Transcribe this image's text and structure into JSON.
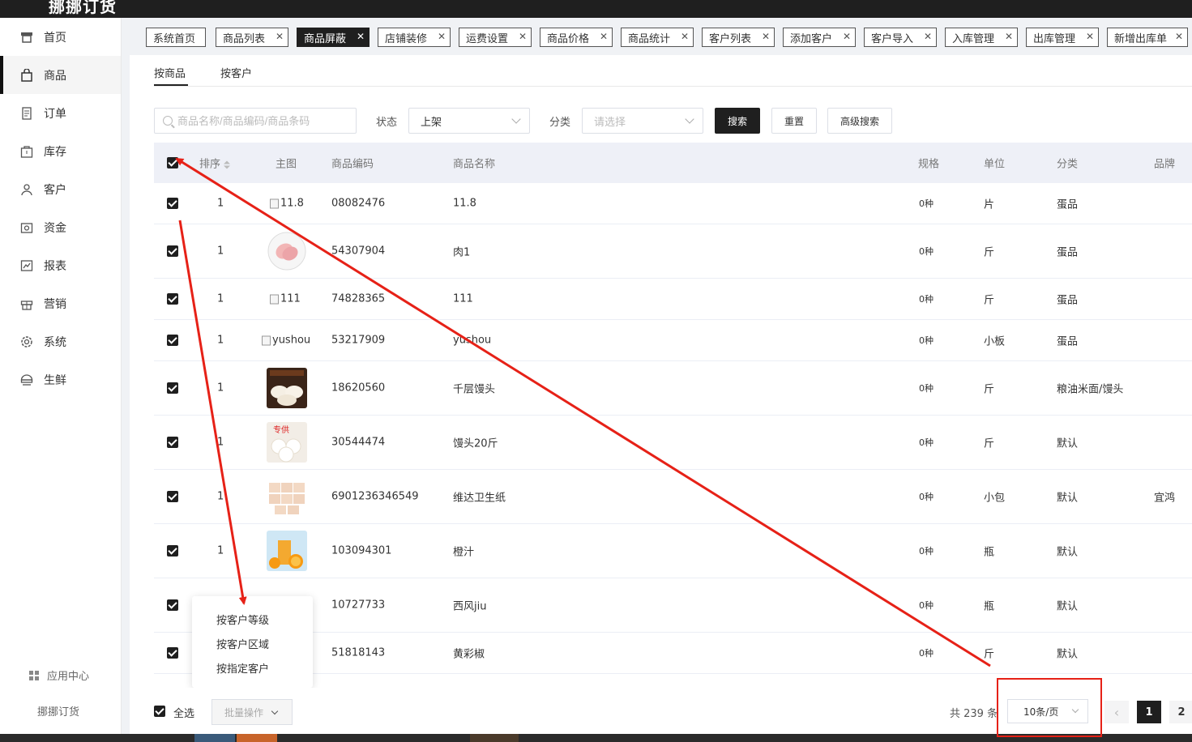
{
  "app": {
    "brand": "挪挪订货"
  },
  "sidebar": {
    "items": [
      {
        "label": "首页",
        "icon": "storefront-icon"
      },
      {
        "label": "商品",
        "icon": "shopping-bag-icon",
        "active": true
      },
      {
        "label": "订单",
        "icon": "document-icon"
      },
      {
        "label": "库存",
        "icon": "box-icon"
      },
      {
        "label": "客户",
        "icon": "user-icon"
      },
      {
        "label": "资金",
        "icon": "wallet-icon"
      },
      {
        "label": "报表",
        "icon": "chart-icon"
      },
      {
        "label": "营销",
        "icon": "gift-icon"
      },
      {
        "label": "系统",
        "icon": "gear-icon"
      },
      {
        "label": "生鲜",
        "icon": "food-icon"
      }
    ],
    "app_center": "应用中心",
    "footer_brand": "挪挪订货"
  },
  "tabs": [
    {
      "label": "系统首页",
      "closable": false
    },
    {
      "label": "商品列表",
      "closable": true
    },
    {
      "label": "商品屏蔽",
      "closable": true,
      "active": true
    },
    {
      "label": "店铺装修",
      "closable": true
    },
    {
      "label": "运费设置",
      "closable": true
    },
    {
      "label": "商品价格",
      "closable": true
    },
    {
      "label": "商品统计",
      "closable": true
    },
    {
      "label": "客户列表",
      "closable": true
    },
    {
      "label": "添加客户",
      "closable": true
    },
    {
      "label": "客户导入",
      "closable": true
    },
    {
      "label": "入库管理",
      "closable": true
    },
    {
      "label": "出库管理",
      "closable": true
    },
    {
      "label": "新增出库单",
      "closable": true
    }
  ],
  "subtabs": [
    {
      "label": "按商品",
      "active": true
    },
    {
      "label": "按客户"
    }
  ],
  "filters": {
    "search_placeholder": "商品名称/商品编码/商品条码",
    "status_label": "状态",
    "status_value": "上架",
    "category_label": "分类",
    "category_placeholder": "请选择",
    "search_btn": "搜索",
    "reset_btn": "重置",
    "advanced_btn": "高级搜索"
  },
  "table": {
    "headers": {
      "sort": "排序",
      "image": "主图",
      "code": "商品编码",
      "name": "商品名称",
      "spec": "规格",
      "unit": "单位",
      "category": "分类",
      "brand": "品牌"
    },
    "rows": [
      {
        "sort": "1",
        "image_alt": "11.8",
        "image": "broken",
        "code": "08082476",
        "name": "11.8",
        "spec": "0种",
        "unit": "片",
        "category": "蛋品",
        "brand": ""
      },
      {
        "sort": "1",
        "image": "meat",
        "code": "54307904",
        "name": "肉1",
        "spec": "0种",
        "unit": "斤",
        "category": "蛋品",
        "brand": ""
      },
      {
        "sort": "1",
        "image_alt": "111",
        "image": "broken",
        "code": "74828365",
        "name": "111",
        "spec": "0种",
        "unit": "斤",
        "category": "蛋品",
        "brand": ""
      },
      {
        "sort": "1",
        "image_alt": "yushou",
        "image": "broken",
        "code": "53217909",
        "name": "yushou",
        "spec": "0种",
        "unit": "小板",
        "category": "蛋品",
        "brand": ""
      },
      {
        "sort": "1",
        "image": "buns-dark",
        "code": "18620560",
        "name": "千层馒头",
        "spec": "0种",
        "unit": "斤",
        "category": "粮油米面/馒头",
        "brand": ""
      },
      {
        "sort": "1",
        "image": "buns-white",
        "code": "30544474",
        "name": "馒头20斤",
        "spec": "0种",
        "unit": "斤",
        "category": "默认",
        "brand": ""
      },
      {
        "sort": "1",
        "image": "tissue",
        "code": "6901236346549",
        "name": "维达卫生纸",
        "spec": "0种",
        "unit": "小包",
        "category": "默认",
        "brand": "宜鸿"
      },
      {
        "sort": "1",
        "image": "juice",
        "code": "103094301",
        "name": "橙汁",
        "spec": "0种",
        "unit": "瓶",
        "category": "默认",
        "brand": ""
      },
      {
        "sort": "",
        "image": "hidden",
        "code": "10727733",
        "name": "西风jiu",
        "spec": "0种",
        "unit": "瓶",
        "category": "默认",
        "brand": ""
      },
      {
        "sort": "",
        "image": "hidden",
        "code": "51818143",
        "name": "黄彩椒",
        "spec": "0种",
        "unit": "斤",
        "category": "默认",
        "brand": ""
      }
    ]
  },
  "batch_menu": {
    "options": [
      "按客户等级",
      "按客户区域",
      "按指定客户"
    ]
  },
  "footer": {
    "select_all": "全选",
    "batch_btn": "批量操作",
    "total": "共 239 条",
    "page_size": "10条/页",
    "pages": [
      "1",
      "2"
    ],
    "prev_arrow": "‹"
  },
  "colors": {
    "accent": "#1f1f1f",
    "annotation": "#e62117"
  }
}
